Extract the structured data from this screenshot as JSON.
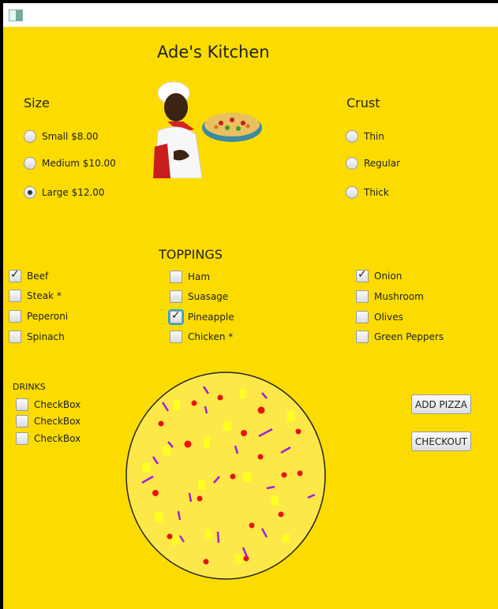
{
  "window": {
    "icon": "app-window-icon"
  },
  "title": "Ade's Kitchen",
  "size": {
    "heading": "Size",
    "options": [
      {
        "label": "Small  $8.00",
        "selected": false
      },
      {
        "label": "Medium $10.00",
        "selected": false
      },
      {
        "label": "Large $12.00",
        "selected": true
      }
    ]
  },
  "crust": {
    "heading": "Crust",
    "options": [
      {
        "label": "Thin",
        "selected": false
      },
      {
        "label": "Regular",
        "selected": false
      },
      {
        "label": "Thick",
        "selected": false
      }
    ]
  },
  "chef_image": "chef-holding-pizza-illustration",
  "toppings": {
    "heading": "TOPPINGS",
    "column1": [
      {
        "label": "Beef",
        "checked": true
      },
      {
        "label": "Steak *",
        "checked": false
      },
      {
        "label": "Peperoni",
        "checked": false
      },
      {
        "label": "Spinach",
        "checked": false
      }
    ],
    "column2": [
      {
        "label": "Ham",
        "checked": false
      },
      {
        "label": "Suasage",
        "checked": false
      },
      {
        "label": "Pineapple",
        "checked": true,
        "focused": true
      },
      {
        "label": "Chicken *",
        "checked": false
      }
    ],
    "column3": [
      {
        "label": "Onion",
        "checked": true
      },
      {
        "label": "Mushroom",
        "checked": false
      },
      {
        "label": "Olives",
        "checked": false
      },
      {
        "label": "Green Peppers",
        "checked": false
      }
    ]
  },
  "drinks": {
    "heading": "DRINKS",
    "items": [
      {
        "label": "CheckBox",
        "checked": false
      },
      {
        "label": "CheckBox",
        "checked": false
      },
      {
        "label": "CheckBox",
        "checked": false
      }
    ]
  },
  "buttons": {
    "add_pizza": "ADD PIZZA",
    "checkout": "CHECKOUT"
  },
  "pizza_preview": "pizza-preview-graphic",
  "colors": {
    "background": "#FCDC00",
    "pizza_cheese": "#FDE84A",
    "beef": "#E8130F",
    "onion": "#A020D8",
    "pineapple": "#FFFF22"
  }
}
